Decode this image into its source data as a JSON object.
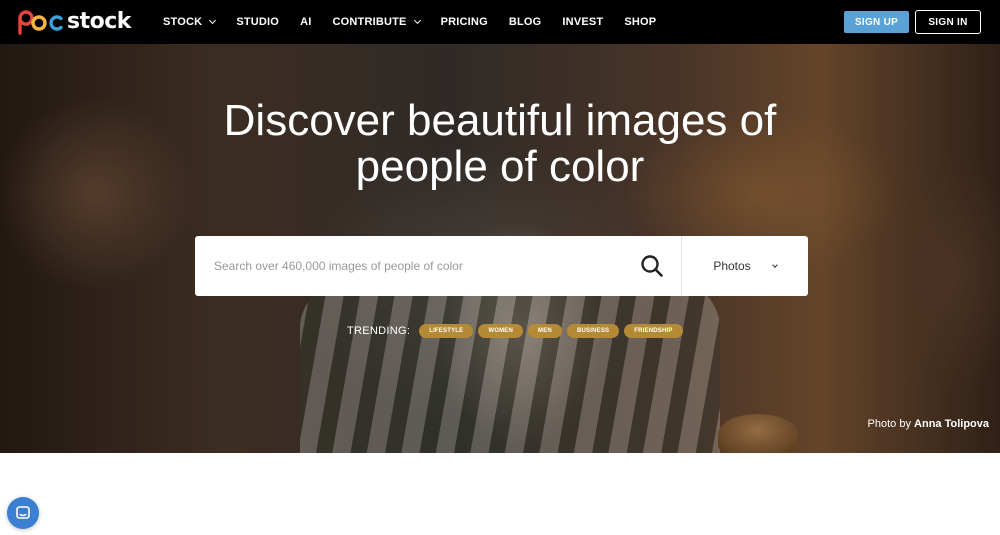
{
  "brand": {
    "logo_text": "stock",
    "logo_colors": [
      "#e8443b",
      "#f6b73c",
      "#3ba0d9"
    ]
  },
  "nav": {
    "items": [
      {
        "label": "STOCK",
        "has_dropdown": true
      },
      {
        "label": "STUDIO",
        "has_dropdown": false
      },
      {
        "label": "AI",
        "has_dropdown": false
      },
      {
        "label": "CONTRIBUTE",
        "has_dropdown": true
      },
      {
        "label": "PRICING",
        "has_dropdown": false
      },
      {
        "label": "BLOG",
        "has_dropdown": false
      },
      {
        "label": "INVEST",
        "has_dropdown": false
      },
      {
        "label": "SHOP",
        "has_dropdown": false
      }
    ],
    "signup_label": "SIGN UP",
    "signin_label": "SIGN IN",
    "signup_color": "#5aa2d6"
  },
  "hero": {
    "headline_line1": "Discover beautiful images of",
    "headline_line2": "people of color",
    "search": {
      "placeholder": "Search over 460,000 images of people of color",
      "value": "",
      "icon": "search-icon"
    },
    "media_type": {
      "selected": "Photos"
    },
    "trending": {
      "label": "TRENDING:",
      "tags": [
        "LIFESTYLE",
        "WOMEN",
        "MEN",
        "BUSINESS",
        "FRIENDSHIP"
      ],
      "tag_color": "#b58a36"
    },
    "credit_prefix": "Photo by",
    "credit_author": "Anna Tolipova"
  },
  "chat_widget": {
    "icon": "chat-icon",
    "color": "#3b7fd1"
  }
}
